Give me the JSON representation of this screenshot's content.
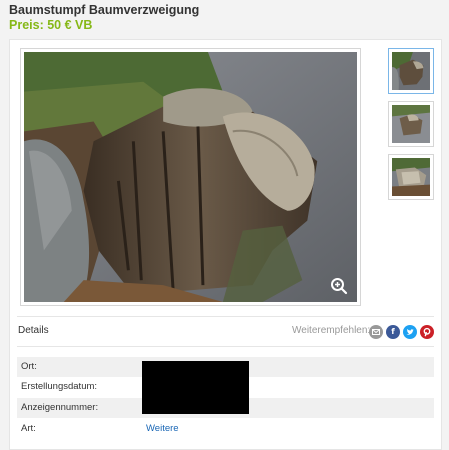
{
  "listing": {
    "title": "Baumstumpf Baumverzweigung",
    "price": "Preis: 50 € VB"
  },
  "gallery": {
    "main_image": "tree-stump-photo",
    "thumbnails": [
      "tree-stump-photo-1",
      "tree-stump-photo-2",
      "tree-stump-photo-3"
    ],
    "active_thumbnail": 1,
    "zoom_icon": "zoom-icon"
  },
  "details": {
    "heading": "Details",
    "share_label": "Weiterempfehlen:",
    "share_icons": [
      {
        "name": "email-icon",
        "color": "#999999"
      },
      {
        "name": "facebook-icon",
        "color": "#3b5998"
      },
      {
        "name": "twitter-icon",
        "color": "#1da1f2"
      },
      {
        "name": "pinterest-icon",
        "color": "#cb2027"
      }
    ],
    "rows": [
      {
        "label": "Ort:",
        "value": ""
      },
      {
        "label": "Erstellungsdatum:",
        "value": ""
      },
      {
        "label": "Anzeigennummer:",
        "value": ""
      },
      {
        "label": "Art:",
        "value": "Weitere"
      }
    ]
  },
  "colors": {
    "price": "#86b817",
    "link": "#1a67b5"
  }
}
